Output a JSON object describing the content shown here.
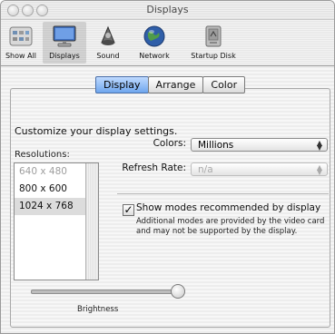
{
  "window": {
    "title": "Displays"
  },
  "toolbar": {
    "items": [
      {
        "label": "Show All",
        "icon": "show-all-icon"
      },
      {
        "label": "Displays",
        "icon": "displays-icon",
        "selected": true
      },
      {
        "label": "Sound",
        "icon": "sound-icon"
      },
      {
        "label": "Network",
        "icon": "network-icon"
      },
      {
        "label": "Startup Disk",
        "icon": "startup-disk-icon"
      }
    ]
  },
  "tabs": [
    {
      "label": "Display",
      "active": true
    },
    {
      "label": "Arrange",
      "active": false
    },
    {
      "label": "Color",
      "active": false
    }
  ],
  "display": {
    "intro": "Customize your display settings.",
    "resolutions_label": "Resolutions:",
    "resolutions": [
      "640 x 480",
      "800 x 600",
      "1024 x 768"
    ],
    "resolution_selected": "1024 x 768",
    "colors_label": "Colors:",
    "colors_value": "Millions",
    "refresh_label": "Refresh Rate:",
    "refresh_value": "n/a",
    "show_modes_label": "Show modes recommended by display",
    "show_modes_checked": true,
    "note": "Additional modes are provided by the video card and may not be supported by the display.",
    "brightness_label": "Brightness",
    "brightness_level": 0.95
  },
  "colors": {
    "accent_tab": "#6fa6ee",
    "selected_row": "#dcdcdc"
  }
}
